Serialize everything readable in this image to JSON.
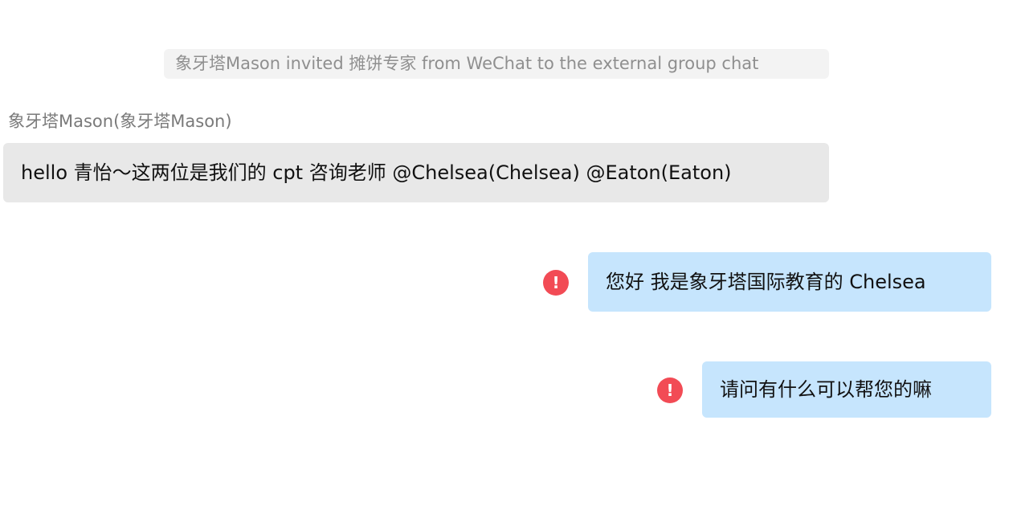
{
  "system_notice": {
    "text": "象牙塔Mason invited  摊饼专家 from WeChat to the external group chat"
  },
  "messages": [
    {
      "direction": "incoming",
      "sender": "象牙塔Mason(象牙塔Mason)",
      "text": "hello 青怡～这两位是我们的 cpt 咨询老师 @Chelsea(Chelsea) @Eaton(Eaton)"
    },
    {
      "direction": "outgoing",
      "text": "您好 我是象牙塔国际教育的 Chelsea",
      "status": "send-failed"
    },
    {
      "direction": "outgoing",
      "text": "请问有什么可以帮您的嘛",
      "status": "send-failed"
    }
  ],
  "icons": {
    "error_glyph": "!",
    "error_icon_name": "send-failed-alert-icon"
  },
  "colors": {
    "incoming_bubble": "#e8e8e8",
    "outgoing_bubble": "#c6e5fd",
    "error_red": "#f24b55",
    "notice_background": "#f3f3f3",
    "muted_text": "#8f8f8f"
  }
}
